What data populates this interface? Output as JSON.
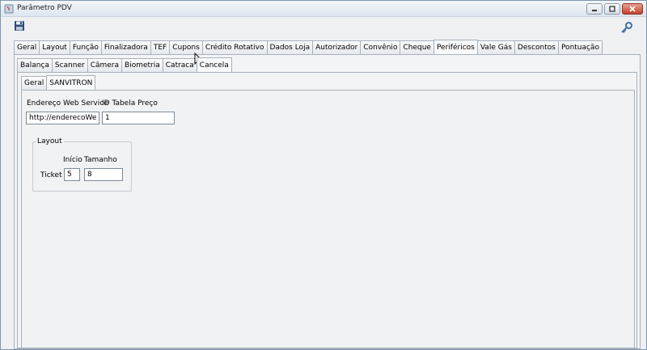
{
  "window": {
    "title": "Parâmetro PDV"
  },
  "toolbar": {
    "save_icon": "floppy-disk-icon",
    "settings_icon": "key-icon"
  },
  "tabs_main": [
    {
      "label": "Geral"
    },
    {
      "label": "Layout"
    },
    {
      "label": "Função"
    },
    {
      "label": "Finalizadora"
    },
    {
      "label": "TEF"
    },
    {
      "label": "Cupons"
    },
    {
      "label": "Crédito Rotativo"
    },
    {
      "label": "Dados Loja"
    },
    {
      "label": "Autorizador"
    },
    {
      "label": "Convênio"
    },
    {
      "label": "Cheque"
    },
    {
      "label": "Periféricos"
    },
    {
      "label": "Vale Gás"
    },
    {
      "label": "Descontos"
    },
    {
      "label": "Pontuação"
    }
  ],
  "tabs_main_active": "Periféricos",
  "tabs_peripherals": [
    {
      "label": "Balança"
    },
    {
      "label": "Scanner"
    },
    {
      "label": "Câmera"
    },
    {
      "label": "Biometria"
    },
    {
      "label": "Catraca"
    },
    {
      "label": "Cancela"
    }
  ],
  "tabs_peripherals_active": "Cancela",
  "tabs_cancela": [
    {
      "label": "Geral"
    },
    {
      "label": "SANVITRON"
    }
  ],
  "tabs_cancela_active": "SANVITRON",
  "form": {
    "webservice_label": "Endereço Web Service",
    "webservice_value": "http://enderecoWebS",
    "price_table_label": "ID Tabela Preço",
    "price_table_value": "1",
    "layout_group_title": "Layout",
    "start_label": "Início",
    "size_label": "Tamanho",
    "ticket_label": "Ticket",
    "ticket_start_value": "5",
    "ticket_size_value": "8"
  }
}
